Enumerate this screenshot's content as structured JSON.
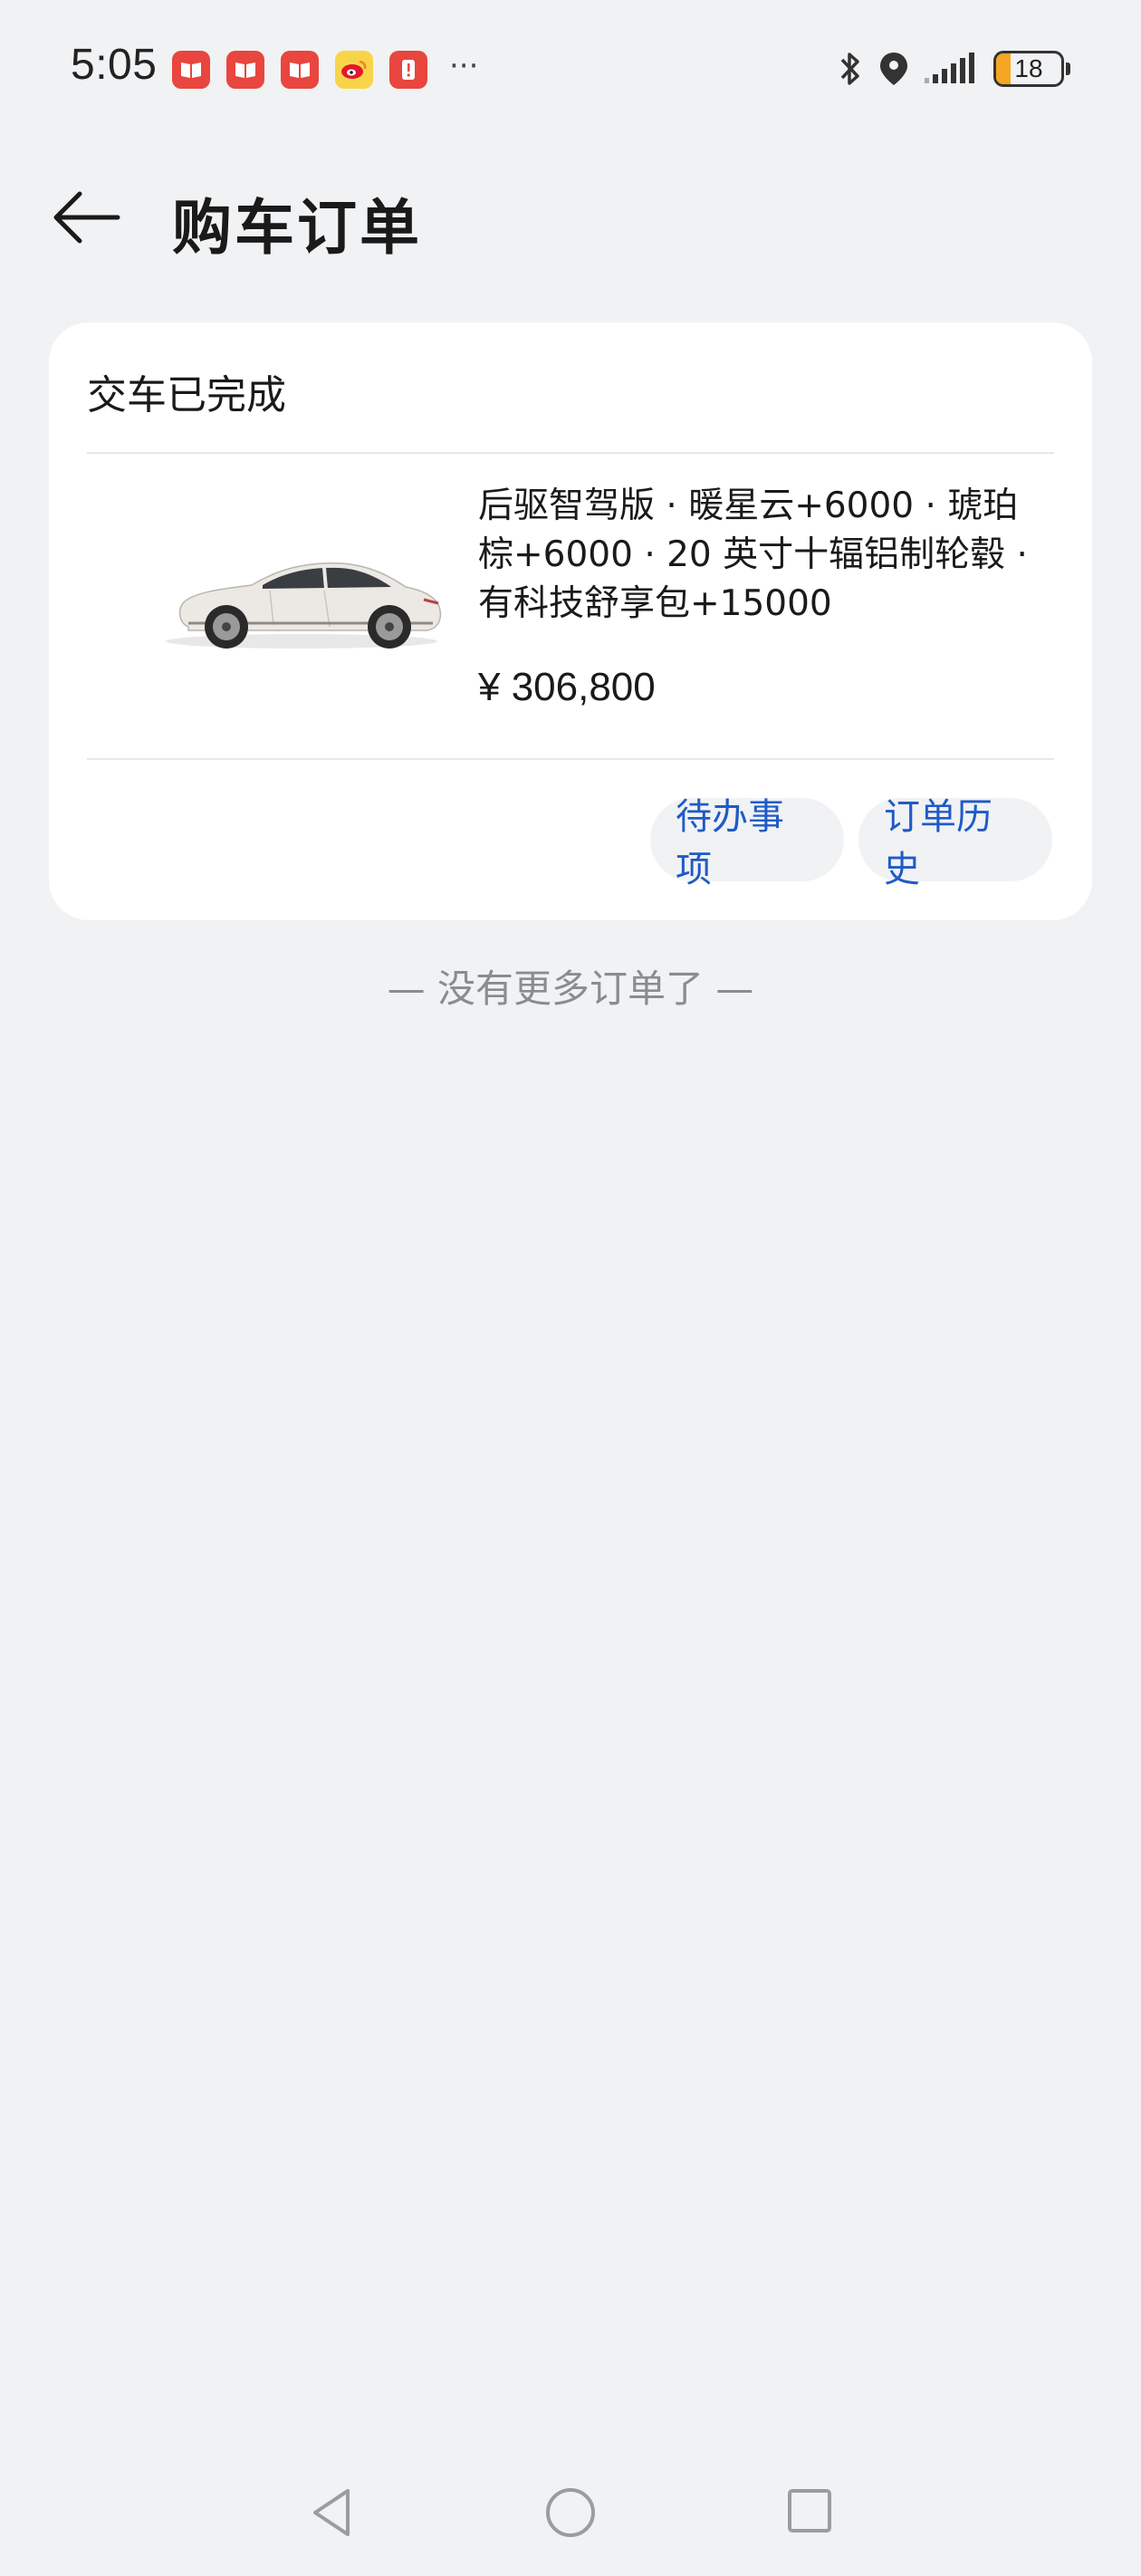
{
  "status_bar": {
    "time": "5:05",
    "battery_level": "18",
    "more_indicator": "···",
    "notification_icons": [
      "red-book-icon",
      "red-book-icon",
      "red-book-icon",
      "weibo-icon",
      "alert-app-icon"
    ],
    "status_icons": [
      "bluetooth-icon",
      "location-icon",
      "signal-icon",
      "battery-icon"
    ]
  },
  "header": {
    "title": "购车订单",
    "back_icon": "back-arrow-icon"
  },
  "order": {
    "status": "交车已完成",
    "config": "后驱智驾版 · 暖星云+6000 · 琥珀棕+6000 · 20 英寸十辐铝制轮毂 · 有科技舒享包+15000",
    "price": "¥ 306,800",
    "buttons": {
      "todo": "待办事项",
      "history": "订单历史"
    }
  },
  "footer_note": "— 没有更多订单了 —",
  "colors": {
    "background": "#f1f2f4",
    "card": "#ffffff",
    "accent": "#1f5bc6",
    "muted_text": "#8a8c91",
    "battery_low": "#f5a623"
  },
  "nav_bar": {
    "icons": [
      "nav-back-icon",
      "nav-home-icon",
      "nav-recent-icon"
    ]
  }
}
